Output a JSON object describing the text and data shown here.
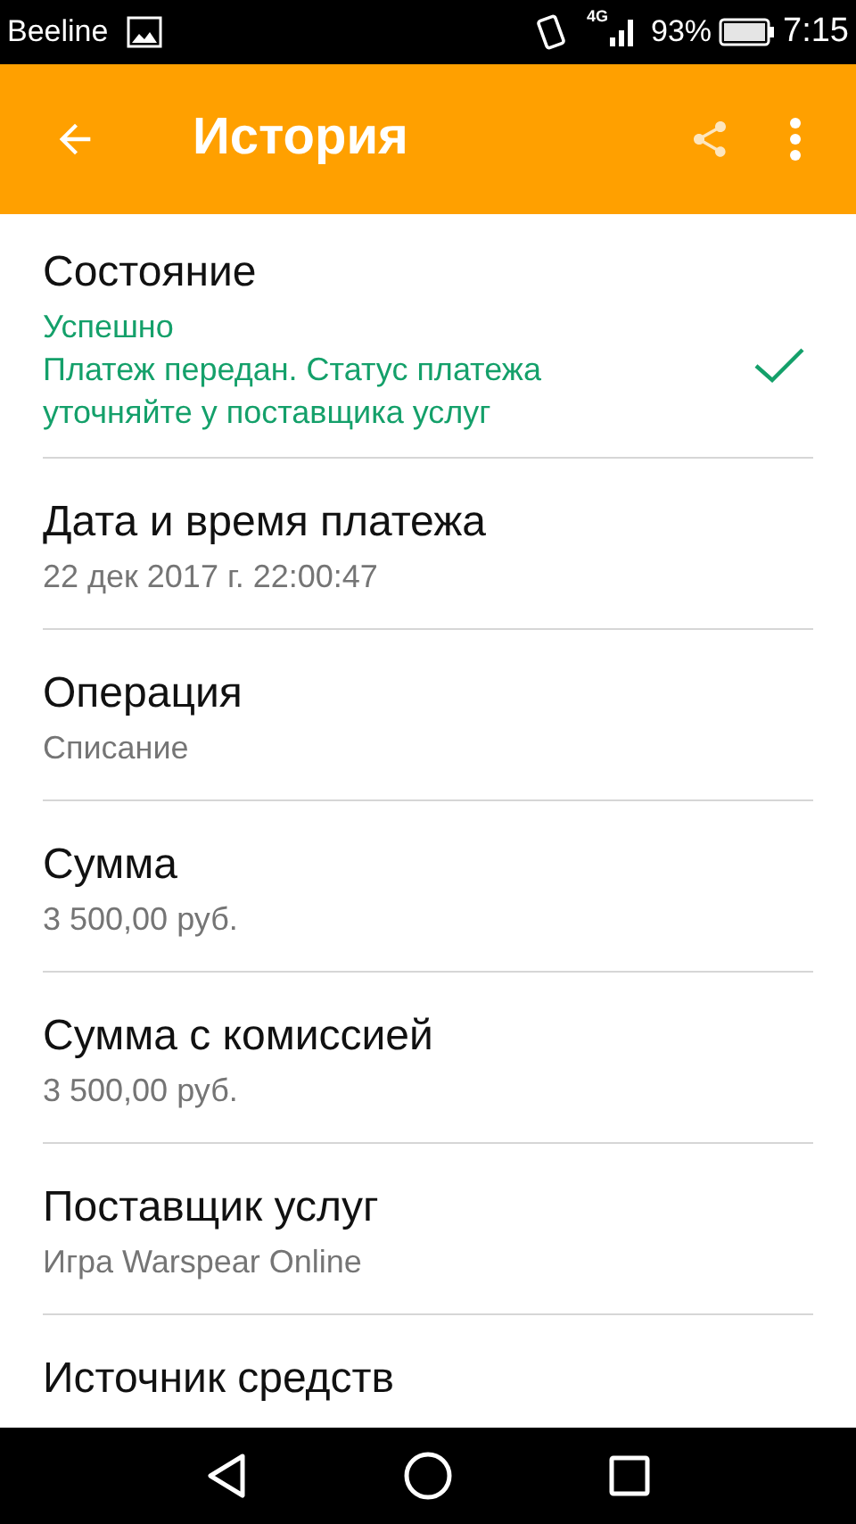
{
  "status_bar": {
    "carrier": "Beeline",
    "network": "4G",
    "battery": "93%",
    "time": "7:15"
  },
  "app_bar": {
    "title": "История"
  },
  "details": [
    {
      "kind": "status",
      "title": "Состояние",
      "value": "Успешно",
      "note": "Платеж передан. Статус платежа уточняйте у поставщика услуг",
      "checked": true
    },
    {
      "kind": "plain",
      "title": "Дата и время платежа",
      "value": "22 дек 2017 г. 22:00:47"
    },
    {
      "kind": "plain",
      "title": "Операция",
      "value": "Списание"
    },
    {
      "kind": "plain",
      "title": "Сумма",
      "value": "3 500,00 руб."
    },
    {
      "kind": "plain",
      "title": "Сумма с комиссией",
      "value": "3 500,00 руб."
    },
    {
      "kind": "plain",
      "title": "Поставщик услуг",
      "value": "Игра Warspear Online"
    },
    {
      "kind": "plain",
      "title": "Источник средств"
    }
  ]
}
